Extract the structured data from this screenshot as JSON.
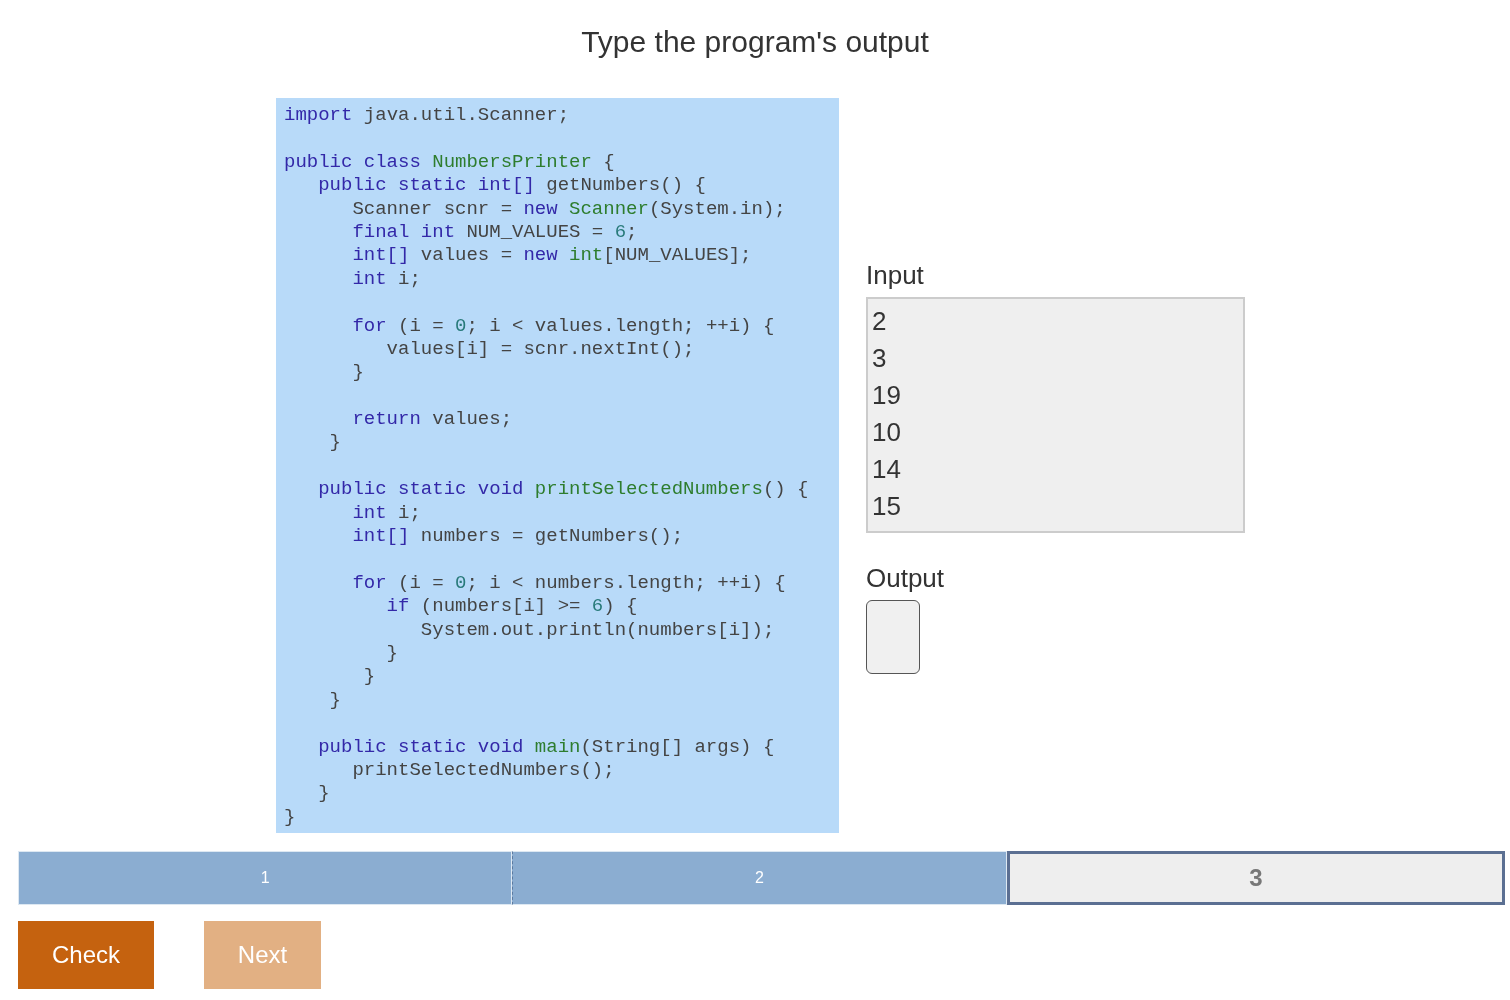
{
  "title": "Type the program's output",
  "code": {
    "lines": [
      {
        "kind": "code",
        "tokens": [
          {
            "kind": "kw",
            "text": "import"
          },
          {
            "kind": "plain",
            "text": " java.util.Scanner;"
          }
        ]
      },
      {
        "kind": "blank"
      },
      {
        "kind": "code",
        "tokens": [
          {
            "kind": "kw",
            "text": "public class "
          },
          {
            "kind": "fn",
            "text": "NumbersPrinter"
          },
          {
            "kind": "plain",
            "text": " {"
          }
        ]
      },
      {
        "kind": "code",
        "tokens": [
          {
            "kind": "kw",
            "text": "   public static int[]"
          },
          {
            "kind": "plain",
            "text": " getNumbers() {"
          }
        ]
      },
      {
        "kind": "code",
        "tokens": [
          {
            "kind": "plain",
            "text": "      Scanner scnr = "
          },
          {
            "kind": "kw",
            "text": "new "
          },
          {
            "kind": "fn",
            "text": "Scanner"
          },
          {
            "kind": "plain",
            "text": "(System.in);"
          }
        ]
      },
      {
        "kind": "code",
        "tokens": [
          {
            "kind": "kw",
            "text": "      final int"
          },
          {
            "kind": "plain",
            "text": " NUM_VALUES = "
          },
          {
            "kind": "num",
            "text": "6"
          },
          {
            "kind": "plain",
            "text": ";"
          }
        ]
      },
      {
        "kind": "code",
        "tokens": [
          {
            "kind": "kw",
            "text": "      int[]"
          },
          {
            "kind": "plain",
            "text": " values = "
          },
          {
            "kind": "kw",
            "text": "new "
          },
          {
            "kind": "fn",
            "text": "int"
          },
          {
            "kind": "plain",
            "text": "[NUM_VALUES];"
          }
        ]
      },
      {
        "kind": "code",
        "tokens": [
          {
            "kind": "kw",
            "text": "      int"
          },
          {
            "kind": "plain",
            "text": " i;"
          }
        ]
      },
      {
        "kind": "blank"
      },
      {
        "kind": "code",
        "tokens": [
          {
            "kind": "kw",
            "text": "      for"
          },
          {
            "kind": "plain",
            "text": " (i = "
          },
          {
            "kind": "num",
            "text": "0"
          },
          {
            "kind": "plain",
            "text": "; i < values.length; ++i) {"
          }
        ]
      },
      {
        "kind": "code",
        "tokens": [
          {
            "kind": "plain",
            "text": "         values[i] = scnr.nextInt();"
          }
        ]
      },
      {
        "kind": "code",
        "tokens": [
          {
            "kind": "plain",
            "text": "      }"
          }
        ]
      },
      {
        "kind": "blank"
      },
      {
        "kind": "code",
        "tokens": [
          {
            "kind": "kw",
            "text": "      return"
          },
          {
            "kind": "plain",
            "text": " values;"
          }
        ]
      },
      {
        "kind": "code",
        "tokens": [
          {
            "kind": "plain",
            "text": "    }"
          }
        ]
      },
      {
        "kind": "blank"
      },
      {
        "kind": "code",
        "tokens": [
          {
            "kind": "kw",
            "text": "   public static void "
          },
          {
            "kind": "fn",
            "text": "printSelectedNumbers"
          },
          {
            "kind": "plain",
            "text": "() {"
          }
        ]
      },
      {
        "kind": "code",
        "tokens": [
          {
            "kind": "kw",
            "text": "      int"
          },
          {
            "kind": "plain",
            "text": " i;"
          }
        ]
      },
      {
        "kind": "code",
        "tokens": [
          {
            "kind": "kw",
            "text": "      int[]"
          },
          {
            "kind": "plain",
            "text": " numbers = getNumbers();"
          }
        ]
      },
      {
        "kind": "blank"
      },
      {
        "kind": "code",
        "tokens": [
          {
            "kind": "kw",
            "text": "      for"
          },
          {
            "kind": "plain",
            "text": " (i = "
          },
          {
            "kind": "num",
            "text": "0"
          },
          {
            "kind": "plain",
            "text": "; i < numbers.length; ++i) {"
          }
        ]
      },
      {
        "kind": "code",
        "tokens": [
          {
            "kind": "kw",
            "text": "         if"
          },
          {
            "kind": "plain",
            "text": " (numbers[i] >= "
          },
          {
            "kind": "num",
            "text": "6"
          },
          {
            "kind": "plain",
            "text": ") {"
          }
        ]
      },
      {
        "kind": "code",
        "tokens": [
          {
            "kind": "plain",
            "text": "            System.out.println(numbers[i]);"
          }
        ]
      },
      {
        "kind": "code",
        "tokens": [
          {
            "kind": "plain",
            "text": "         }"
          }
        ]
      },
      {
        "kind": "code",
        "tokens": [
          {
            "kind": "plain",
            "text": "       }"
          }
        ]
      },
      {
        "kind": "code",
        "tokens": [
          {
            "kind": "plain",
            "text": "    }"
          }
        ]
      },
      {
        "kind": "blank"
      },
      {
        "kind": "code",
        "tokens": [
          {
            "kind": "kw",
            "text": "   public static void "
          },
          {
            "kind": "fn",
            "text": "main"
          },
          {
            "kind": "plain",
            "text": "(String[] args) {"
          }
        ]
      },
      {
        "kind": "code",
        "tokens": [
          {
            "kind": "plain",
            "text": "      printSelectedNumbers();"
          }
        ]
      },
      {
        "kind": "code",
        "tokens": [
          {
            "kind": "plain",
            "text": "   }"
          }
        ]
      },
      {
        "kind": "code",
        "tokens": [
          {
            "kind": "plain",
            "text": "}"
          }
        ]
      }
    ]
  },
  "input": {
    "label": "Input",
    "values": [
      "2",
      "3",
      "19",
      "10",
      "14",
      "15"
    ]
  },
  "output": {
    "label": "Output"
  },
  "steps": [
    {
      "label": "1",
      "completed": true,
      "selected": false
    },
    {
      "label": "2",
      "completed": true,
      "selected": false
    },
    {
      "label": "3",
      "completed": false,
      "selected": true
    }
  ],
  "buttons": [
    {
      "label": "Check",
      "disabled": false
    },
    {
      "label": "Next",
      "disabled": true
    }
  ]
}
